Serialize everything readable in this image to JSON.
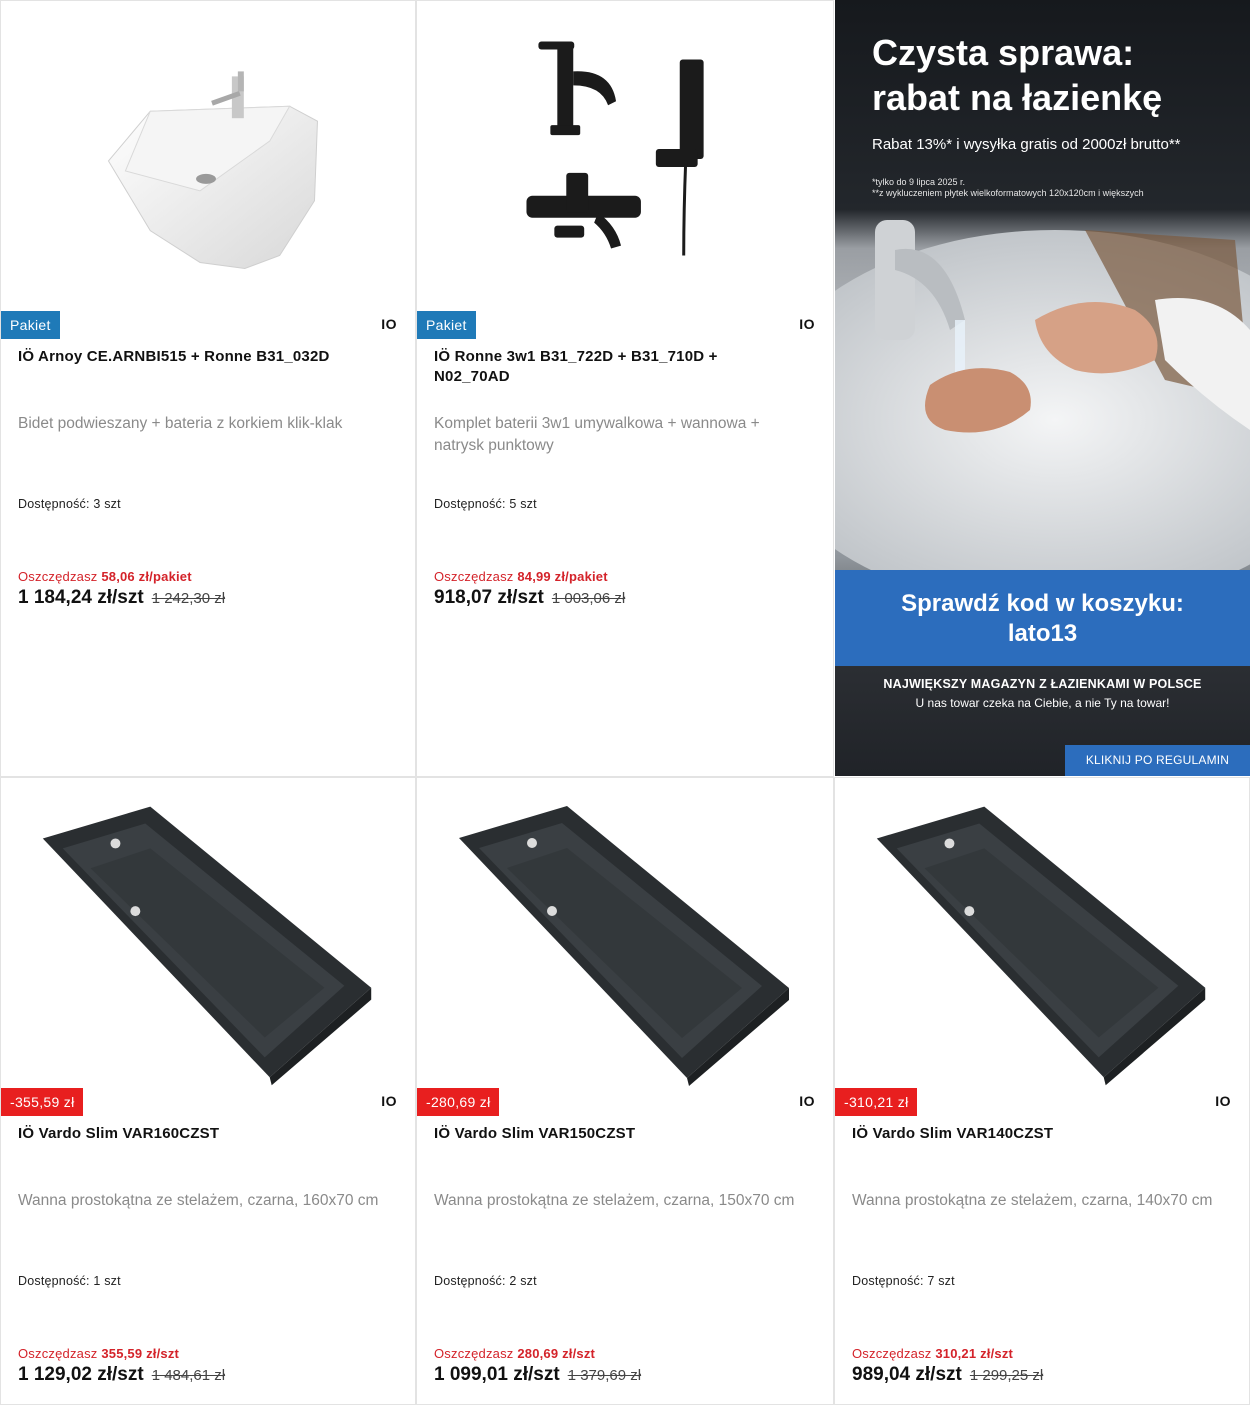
{
  "products": [
    {
      "badge": "Pakiet",
      "badge_type": "pakiet",
      "brand": "IO",
      "title": "IÖ Arnoy CE.ARNBI515 + Ronne B31_032D",
      "description": "Bidet podwieszany + bateria z korkiem klik-klak",
      "availability_label": "Dostępność:",
      "availability": "3 szt",
      "save_label": "Oszczędzasz",
      "save_value": "58,06 zł/pakiet",
      "price": "1 184,24 zł/szt",
      "old_price": "1 242,30 zł",
      "image": "bidet"
    },
    {
      "badge": "Pakiet",
      "badge_type": "pakiet",
      "brand": "IO",
      "title": "IÖ Ronne 3w1 B31_722D + B31_710D + N02_70AD",
      "description": "Komplet baterii 3w1 umywalkowa + wannowa + natrysk punktowy",
      "availability_label": "Dostępność:",
      "availability": "5 szt",
      "save_label": "Oszczędzasz",
      "save_value": "84,99 zł/pakiet",
      "price": "918,07 zł/szt",
      "old_price": "1 003,06 zł",
      "image": "faucets"
    },
    {
      "badge": "-355,59 zł",
      "badge_type": "disc",
      "brand": "IO",
      "title": "IÖ Vardo Slim VAR160CZST",
      "description": "Wanna prostokątna ze stelażem, czarna, 160x70 cm",
      "availability_label": "Dostępność:",
      "availability": "1 szt",
      "save_label": "Oszczędzasz",
      "save_value": "355,59 zł/szt",
      "price": "1 129,02 zł/szt",
      "old_price": "1 484,61 zł",
      "image": "bathtub"
    },
    {
      "badge": "-280,69 zł",
      "badge_type": "disc",
      "brand": "IO",
      "title": "IÖ Vardo Slim VAR150CZST",
      "description": "Wanna prostokątna ze stelażem, czarna, 150x70 cm",
      "availability_label": "Dostępność:",
      "availability": "2 szt",
      "save_label": "Oszczędzasz",
      "save_value": "280,69 zł/szt",
      "price": "1 099,01 zł/szt",
      "old_price": "1 379,69 zł",
      "image": "bathtub"
    },
    {
      "badge": "-310,21 zł",
      "badge_type": "disc",
      "brand": "IO",
      "title": "IÖ Vardo Slim VAR140CZST",
      "description": "Wanna prostokątna ze stelażem, czarna, 140x70 cm",
      "availability_label": "Dostępność:",
      "availability": "7 szt",
      "save_label": "Oszczędzasz",
      "save_value": "310,21 zł/szt",
      "price": "989,04 zł/szt",
      "old_price": "1 299,25 zł",
      "image": "bathtub"
    }
  ],
  "banner": {
    "headline": "Czysta sprawa: rabat na łazienkę",
    "subtitle": "Rabat 13%* i wysyłka gratis od 2000zł brutto**",
    "note1": "*tylko do 9 lipca 2025 r.",
    "note2": "**z wykluczeniem płytek wielkoformatowych 120x120cm i większych",
    "code_line1": "Sprawdź kod w koszyku:",
    "code_line2": "lato13",
    "tagline1": "NAJWIĘKSZY MAGAZYN Z ŁAZIENKAMI W POLSCE",
    "tagline2": "U nas towar czeka na Ciebie, a nie Ty na towar!",
    "button": "KLIKNIJ PO REGULAMIN",
    "accent_color": "#2c6dbd"
  },
  "colors": {
    "pakiet_badge": "#1f7ab8",
    "discount_badge": "#e81f1f",
    "savings_text": "#d4232a"
  }
}
